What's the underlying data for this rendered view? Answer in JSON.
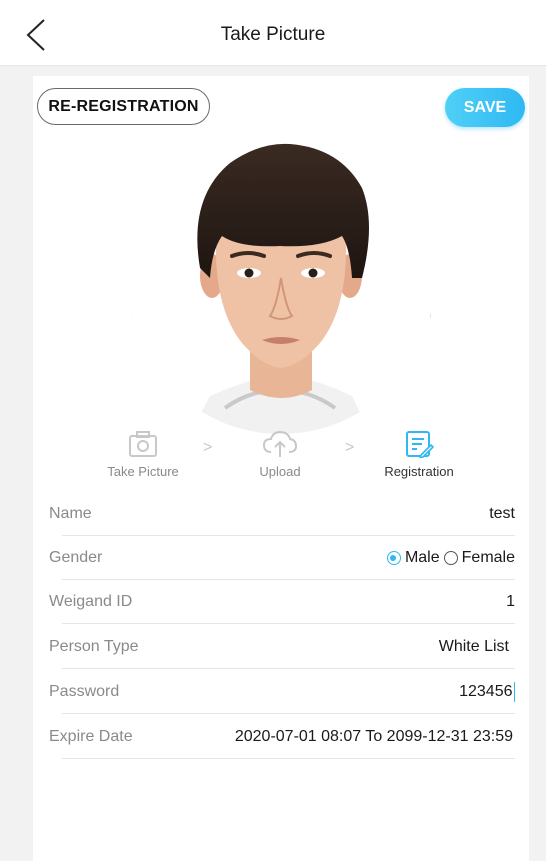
{
  "header": {
    "title": "Take Picture"
  },
  "toolbar": {
    "reregistration_label": "RE-REGISTRATION",
    "save_label": "SAVE"
  },
  "steps": [
    {
      "label": "Take Picture",
      "icon": "camera-icon",
      "state": "done"
    },
    {
      "label": "Upload",
      "icon": "cloud-upload-icon",
      "state": "done"
    },
    {
      "label": "Registration",
      "icon": "edit-document-icon",
      "state": "active"
    }
  ],
  "form": {
    "name": {
      "label": "Name",
      "value": "test"
    },
    "gender": {
      "label": "Gender",
      "options": [
        "Male",
        "Female"
      ],
      "selected": "Male"
    },
    "weigand_id": {
      "label": "Weigand ID",
      "value": "1"
    },
    "person_type": {
      "label": "Person Type",
      "value": "White List"
    },
    "password": {
      "label": "Password",
      "value": "123456"
    },
    "expire_date": {
      "label": "Expire Date",
      "value": "2020-07-01 08:07 To 2099-12-31 23:59"
    }
  },
  "colors": {
    "accent": "#2fb8f2",
    "inactive": "#c8c8c8",
    "label": "#8a8a8a"
  }
}
